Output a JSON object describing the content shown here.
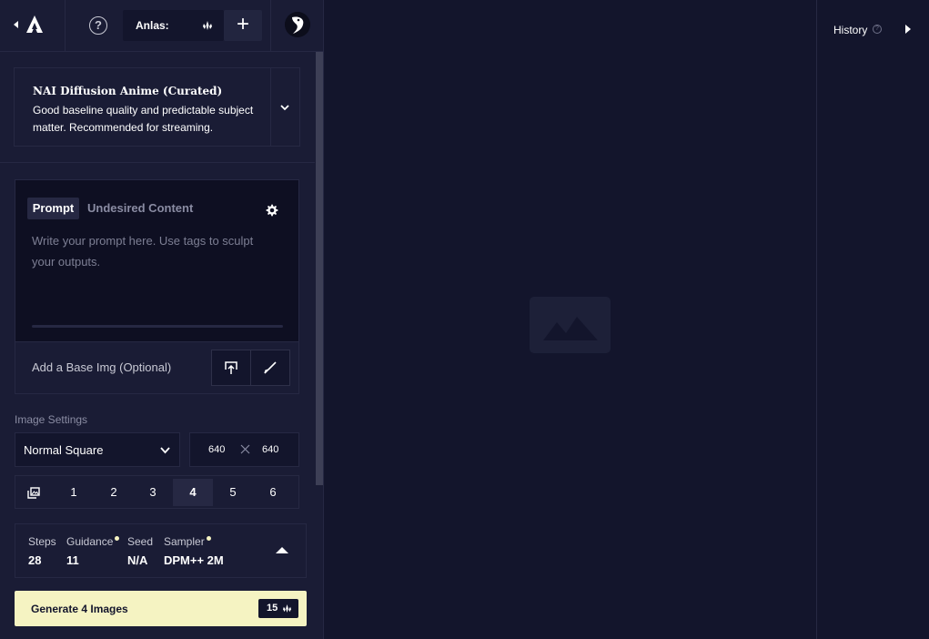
{
  "topbar": {
    "help_glyph": "?",
    "anlas_label": "Anlas:",
    "plus_glyph": "+"
  },
  "model": {
    "name": "NAI Diffusion Anime (Curated)",
    "description": "Good baseline quality and predictable subject matter. Recommended for streaming."
  },
  "prompt": {
    "tab_prompt": "Prompt",
    "tab_undesired": "Undesired Content",
    "placeholder": "Write your prompt here. Use tags to sculpt your outputs.",
    "base_img_label": "Add a Base Img (Optional)"
  },
  "image_settings": {
    "label": "Image Settings",
    "size_preset": "Normal Square",
    "width": "640",
    "height": "640",
    "count_options": [
      "1",
      "2",
      "3",
      "4",
      "5",
      "6"
    ],
    "selected_count": "4"
  },
  "params": {
    "steps_label": "Steps",
    "steps_value": "28",
    "guidance_label": "Guidance",
    "guidance_value": "11",
    "seed_label": "Seed",
    "seed_value": "N/A",
    "sampler_label": "Sampler",
    "sampler_value": "DPM++ 2M"
  },
  "generate": {
    "label": "Generate 4 Images",
    "cost": "15"
  },
  "history": {
    "label": "History",
    "help_glyph": "?"
  },
  "colors": {
    "background": "#13152c",
    "panel": "#1a1c35",
    "accent": "#f5f3c2"
  },
  "icons": [
    "back-arrow-icon",
    "novelai-logo-icon",
    "help-icon",
    "anlas-gem-icon",
    "plus-icon",
    "avatar",
    "chevron-down-icon",
    "gear-icon",
    "upload-icon",
    "paint-brush-icon",
    "times-icon",
    "images-stack-icon",
    "caret-up-icon",
    "image-placeholder-icon",
    "caret-right-icon"
  ]
}
